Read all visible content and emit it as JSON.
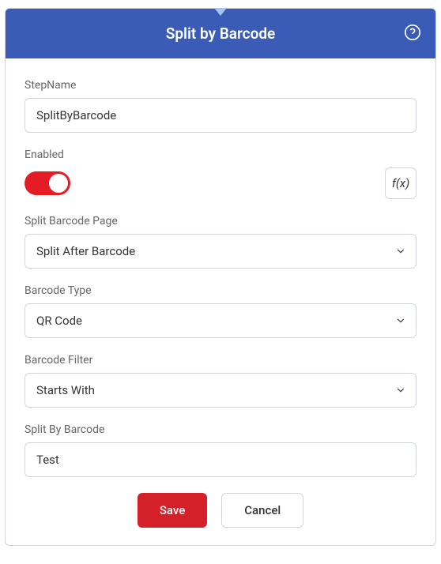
{
  "header": {
    "title": "Split by Barcode"
  },
  "form": {
    "stepName": {
      "label": "StepName",
      "value": "SplitByBarcode"
    },
    "enabled": {
      "label": "Enabled",
      "fx": "f(x)"
    },
    "splitBarcodePage": {
      "label": "Split Barcode Page",
      "value": "Split After Barcode"
    },
    "barcodeType": {
      "label": "Barcode Type",
      "value": "QR Code"
    },
    "barcodeFilter": {
      "label": "Barcode Filter",
      "value": "Starts With"
    },
    "splitByBarcode": {
      "label": "Split By Barcode",
      "value": "Test"
    }
  },
  "buttons": {
    "save": "Save",
    "cancel": "Cancel"
  }
}
